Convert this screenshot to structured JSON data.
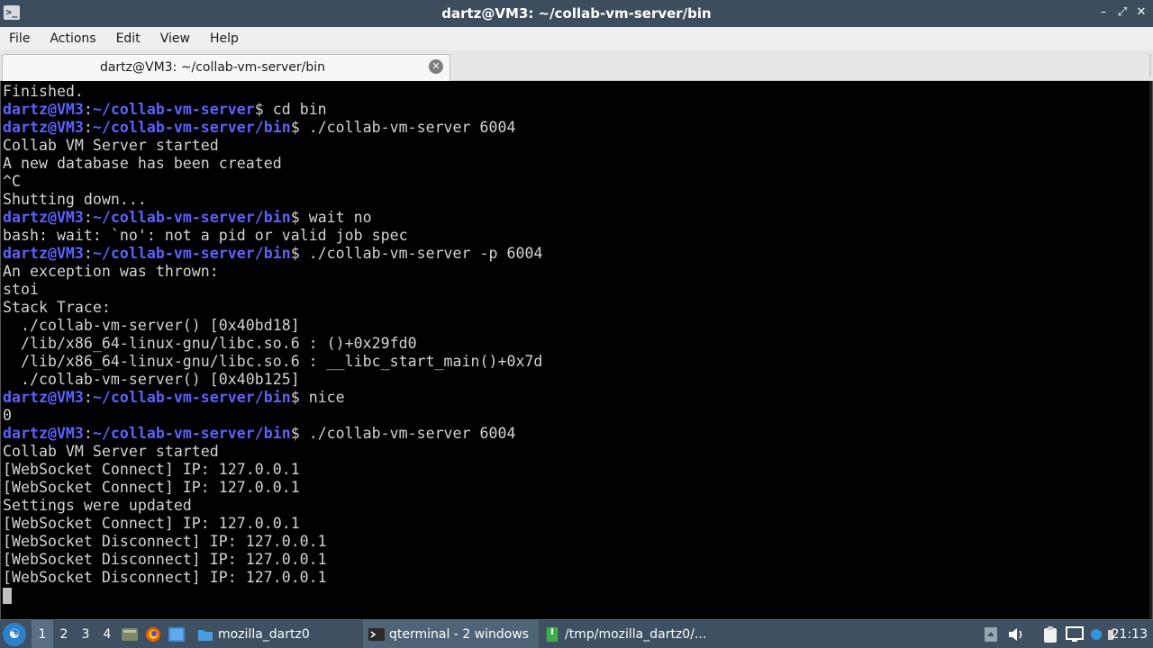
{
  "window": {
    "title": "dartz@VM3: ~/collab-vm-server/bin",
    "controls": [
      "minimize-icon",
      "maximize-icon",
      "close-icon"
    ]
  },
  "menu": {
    "items": [
      "File",
      "Actions",
      "Edit",
      "View",
      "Help"
    ]
  },
  "tabs": [
    {
      "label": "dartz@VM3: ~/collab-vm-server/bin",
      "active": true
    }
  ],
  "terminal": {
    "colors": {
      "background": "#000000",
      "text": "#d3d3d3",
      "prompt": "#5b61ff"
    },
    "lines": [
      {
        "text": "Finished."
      },
      {
        "user": "dartz@VM3",
        "sep": ":",
        "path": "~/collab-vm-server",
        "cmd": "$ cd bin"
      },
      {
        "user": "dartz@VM3",
        "sep": ":",
        "path": "~/collab-vm-server/bin",
        "cmd": "$ ./collab-vm-server 6004"
      },
      {
        "text": "Collab VM Server started"
      },
      {
        "text": "A new database has been created"
      },
      {
        "text": "^C"
      },
      {
        "text": "Shutting down..."
      },
      {
        "user": "dartz@VM3",
        "sep": ":",
        "path": "~/collab-vm-server/bin",
        "cmd": "$ wait no"
      },
      {
        "text": "bash: wait: `no': not a pid or valid job spec"
      },
      {
        "user": "dartz@VM3",
        "sep": ":",
        "path": "~/collab-vm-server/bin",
        "cmd": "$ ./collab-vm-server -p 6004"
      },
      {
        "text": "An exception was thrown:"
      },
      {
        "text": "stoi"
      },
      {
        "text": "Stack Trace:"
      },
      {
        "text": "  ./collab-vm-server() [0x40bd18]"
      },
      {
        "text": "  /lib/x86_64-linux-gnu/libc.so.6 : ()+0x29fd0"
      },
      {
        "text": "  /lib/x86_64-linux-gnu/libc.so.6 : __libc_start_main()+0x7d"
      },
      {
        "text": "  ./collab-vm-server() [0x40b125]"
      },
      {
        "user": "dartz@VM3",
        "sep": ":",
        "path": "~/collab-vm-server/bin",
        "cmd": "$ nice"
      },
      {
        "text": "0"
      },
      {
        "user": "dartz@VM3",
        "sep": ":",
        "path": "~/collab-vm-server/bin",
        "cmd": "$ ./collab-vm-server 6004"
      },
      {
        "text": "Collab VM Server started"
      },
      {
        "text": "[WebSocket Connect] IP: 127.0.0.1"
      },
      {
        "text": "[WebSocket Connect] IP: 127.0.0.1"
      },
      {
        "text": "Settings were updated"
      },
      {
        "text": "[WebSocket Connect] IP: 127.0.0.1"
      },
      {
        "text": "[WebSocket Disconnect] IP: 127.0.0.1"
      },
      {
        "text": "[WebSocket Disconnect] IP: 127.0.0.1"
      },
      {
        "text": "[WebSocket Disconnect] IP: 127.0.0.1"
      }
    ]
  },
  "taskbar": {
    "workspaces": [
      "1",
      "2",
      "3",
      "4"
    ],
    "active_workspace": "1",
    "quicklaunch": [
      "file-manager-icon",
      "firefox-icon",
      "show-desktop-icon"
    ],
    "tasks": [
      {
        "label": "mozilla_dartz0",
        "icon": "folder-icon",
        "active": false
      },
      {
        "label": "qterminal - 2 windows",
        "icon": "terminal-icon",
        "active": true
      },
      {
        "label": "/tmp/mozilla_dartz0/...",
        "icon": "archive-icon",
        "active": false
      }
    ],
    "tray": [
      "scroll-up-icon",
      "volume-icon",
      "clipboard-icon",
      "monitor-icon",
      "network-icon",
      "power-icon"
    ],
    "clock": "21:13"
  }
}
